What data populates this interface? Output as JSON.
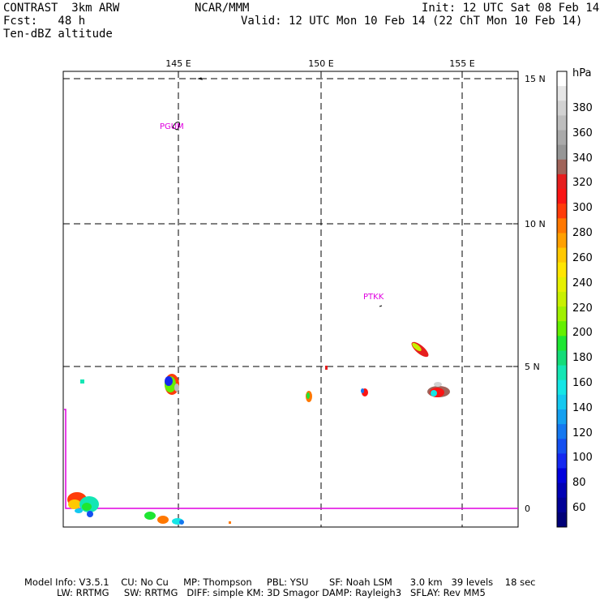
{
  "header": {
    "model": "CONTRAST  3km ARW",
    "center": "NCAR/MMM",
    "init": "Init: 12 UTC Sat 08 Feb 14",
    "fcst": "Fcst:   48 h",
    "valid": "Valid: 12 UTC Mon 10 Feb 14 (22 ChT Mon 10 Feb 14)",
    "field": "Ten-dBZ altitude"
  },
  "axes": {
    "lon_labels": [
      "145 E",
      "150 E",
      "155 E"
    ],
    "lat_labels": [
      "15 N",
      "10 N",
      "5 N",
      "0"
    ]
  },
  "stations": [
    "PGUM",
    "PTKK"
  ],
  "colorbar": {
    "unit": "hPa",
    "labels": [
      "380",
      "360",
      "340",
      "320",
      "300",
      "280",
      "260",
      "240",
      "220",
      "200",
      "180",
      "160",
      "140",
      "120",
      "100",
      "80",
      "60"
    ],
    "colors": [
      "#ffffff",
      "#e6e6e6",
      "#d2d2d2",
      "#bebebe",
      "#aaaaaa",
      "#969696",
      "#a0645a",
      "#e61e1e",
      "#fa1414",
      "#ff3c0a",
      "#ff7800",
      "#ffa000",
      "#ffc800",
      "#ffe600",
      "#e6f000",
      "#c8f000",
      "#a0f000",
      "#64f000",
      "#1ee632",
      "#14dc78",
      "#14e6b4",
      "#14e6e6",
      "#14c8f0",
      "#14a0f0",
      "#1478f0",
      "#1450f0",
      "#1428f0",
      "#0000dc",
      "#0000b4",
      "#000096",
      "#000078"
    ]
  },
  "footer": {
    "line1": "Model Info: V3.5.1    CU: No Cu     MP: Thompson     PBL: YSU       SF: Noah LSM      3.0 km   39 levels    18 sec",
    "line2": "LW: RRTMG     SW: RRTMG   DIFF: simple KM: 3D Smagor DAMP: Rayleigh3   SFLAY: Rev MM5"
  }
}
